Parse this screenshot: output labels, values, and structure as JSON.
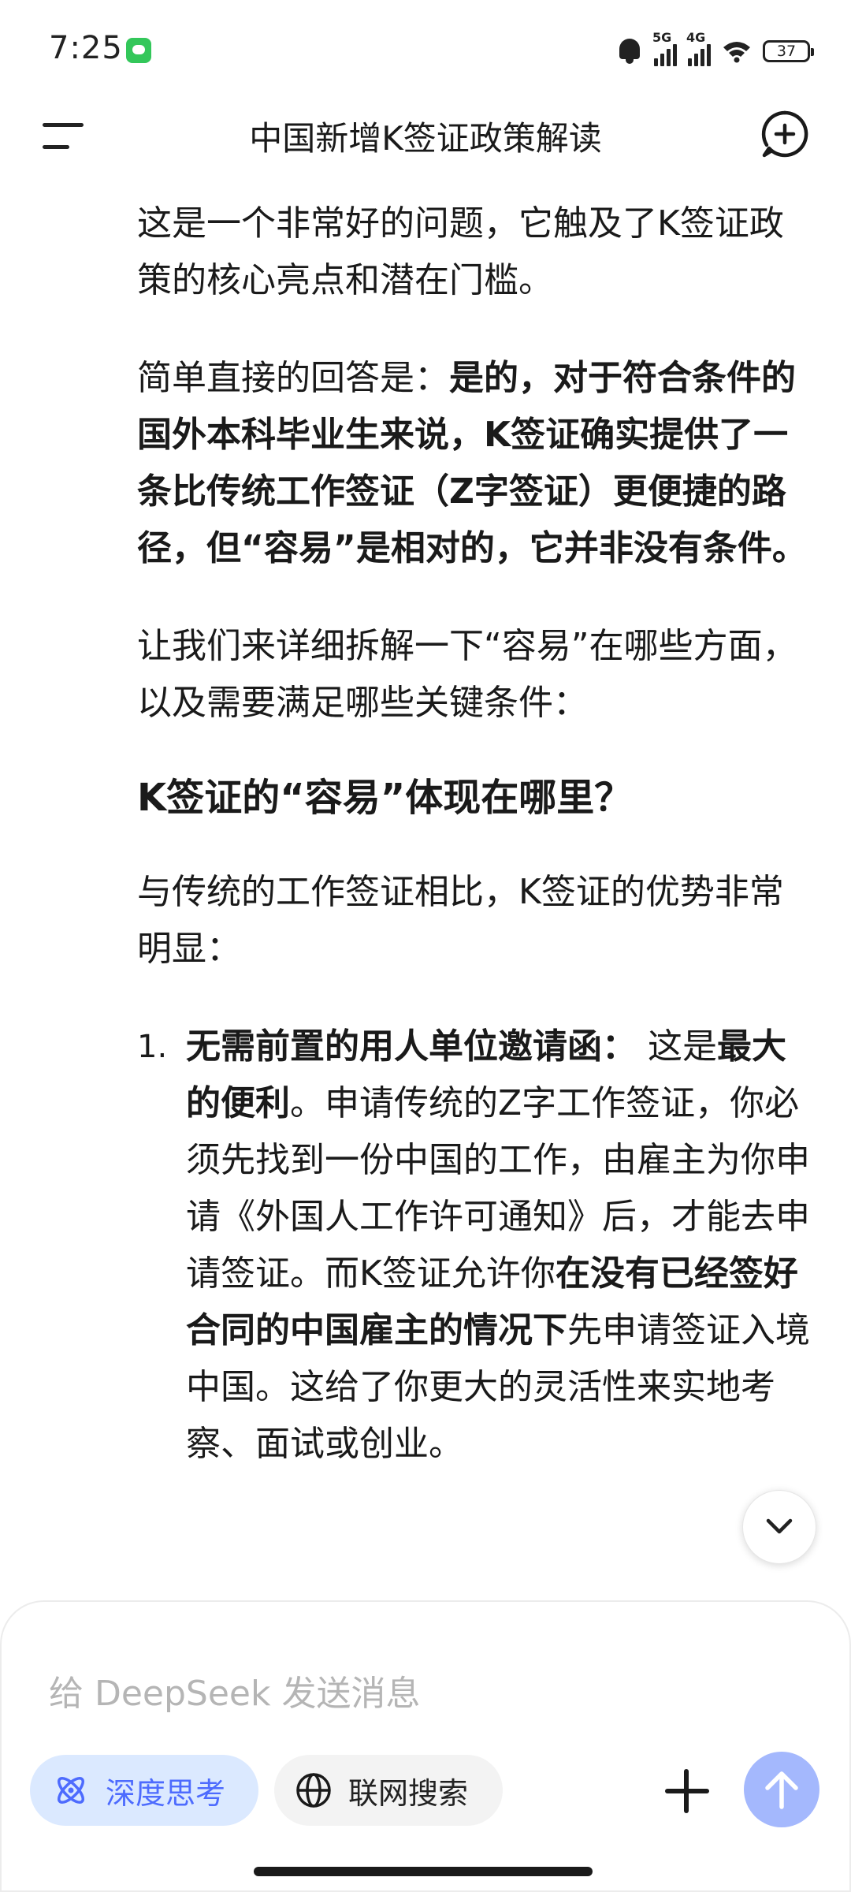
{
  "status_bar": {
    "time": "7:25",
    "signal1": "5G",
    "signal2": "4G",
    "battery": "37"
  },
  "header": {
    "title": "中国新增K签证政策解读"
  },
  "content": {
    "p1": "这是一个非常好的问题，它触及了K签证政策的核心亮点和潜在门槛。",
    "p2_lead": "简单直接的回答是：",
    "p2_bold": "是的，对于符合条件的国外本科毕业生来说，K签证确实提供了一条比传统工作签证（Z字签证）更便捷的路径，但“容易”是相对的，它并非没有条件。",
    "p3": "让我们来详细拆解一下“容易”在哪些方面，以及需要满足哪些关键条件：",
    "h1": "K签证的“容易”体现在哪里？",
    "p4": "与传统的工作签证相比，K签证的优势非常明显：",
    "item1": {
      "num": "1.",
      "bold1": "无需前置的用人单位邀请函：",
      "text1": "  这是",
      "bold2": "最大的便利",
      "text2": "。申请传统的Z字工作签证，你必须先找到一份中国的工作，由雇主为你申请《外国人工作许可通知》后，才能去申请签证。而K签证允许你",
      "bold3": "在没有已经签好合同的中国雇主的情况下",
      "text3": "先申请签证入境中国。这给了你更大的灵活性来实地考察、面试或创业。"
    }
  },
  "composer": {
    "placeholder": "给 DeepSeek 发送消息",
    "deep_think_label": "深度思考",
    "web_search_label": "联网搜索"
  },
  "colors": {
    "accent": "#4d6bfe",
    "accent_light": "#dbe9ff",
    "send_disabled": "#a4b8fd"
  }
}
